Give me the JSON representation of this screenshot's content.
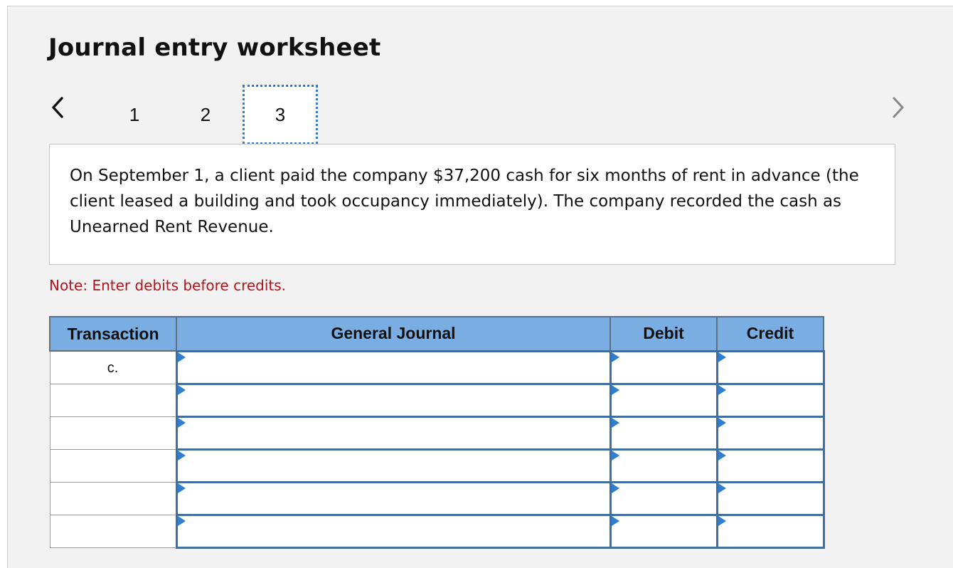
{
  "worksheet": {
    "title": "Journal entry worksheet",
    "tabs": [
      {
        "label": "1"
      },
      {
        "label": "2"
      },
      {
        "label": "3",
        "selected": true
      }
    ],
    "nav": {
      "prev_icon": "chevron-left-icon",
      "next_icon": "chevron-right-icon"
    },
    "description": "On September 1, a client paid the company $37,200 cash for six months of rent in advance (the client leased a building and took occupancy immediately). The company recorded the cash as Unearned Rent Revenue.",
    "note": "Note: Enter debits before credits.",
    "table": {
      "headers": {
        "transaction": "Transaction",
        "general_journal": "General Journal",
        "debit": "Debit",
        "credit": "Credit"
      },
      "rows": [
        {
          "transaction": "c.",
          "general_journal": "",
          "debit": "",
          "credit": ""
        },
        {
          "transaction": "",
          "general_journal": "",
          "debit": "",
          "credit": ""
        },
        {
          "transaction": "",
          "general_journal": "",
          "debit": "",
          "credit": ""
        },
        {
          "transaction": "",
          "general_journal": "",
          "debit": "",
          "credit": ""
        },
        {
          "transaction": "",
          "general_journal": "",
          "debit": "",
          "credit": ""
        },
        {
          "transaction": "",
          "general_journal": "",
          "debit": "",
          "credit": ""
        }
      ]
    },
    "colors": {
      "header_bg": "#7aade2",
      "tab_selected_border": "#3b78c8",
      "note_text": "#b5121b",
      "input_marker": "#2f7fd0"
    }
  }
}
